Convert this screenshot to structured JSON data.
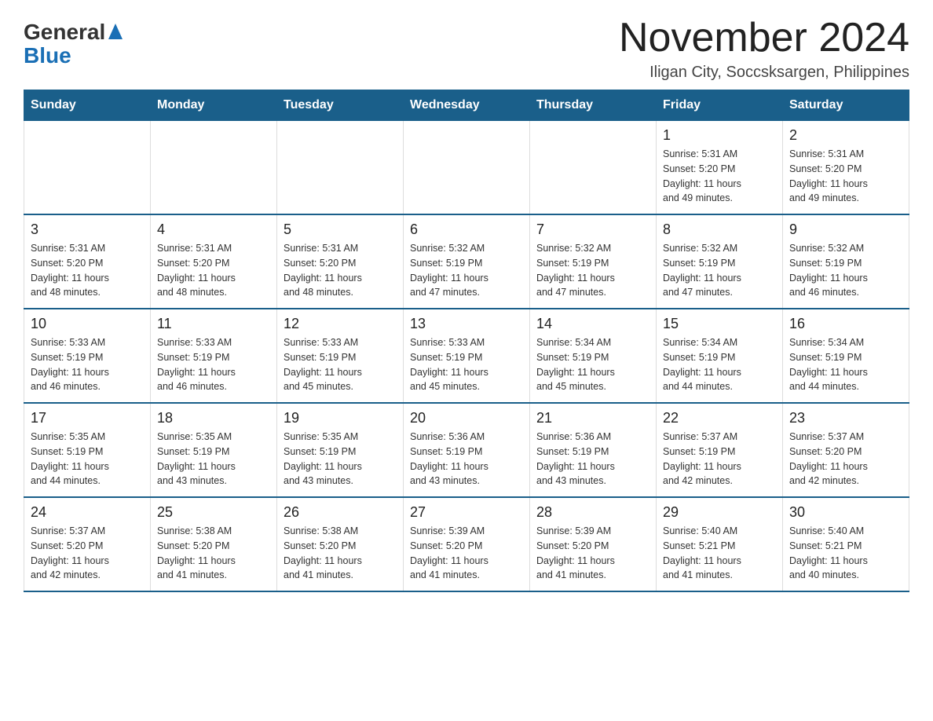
{
  "header": {
    "title": "November 2024",
    "location": "Iligan City, Soccsksargen, Philippines"
  },
  "logo": {
    "general": "General",
    "blue": "Blue"
  },
  "days_of_week": [
    "Sunday",
    "Monday",
    "Tuesday",
    "Wednesday",
    "Thursday",
    "Friday",
    "Saturday"
  ],
  "weeks": [
    [
      {
        "day": "",
        "info": ""
      },
      {
        "day": "",
        "info": ""
      },
      {
        "day": "",
        "info": ""
      },
      {
        "day": "",
        "info": ""
      },
      {
        "day": "",
        "info": ""
      },
      {
        "day": "1",
        "info": "Sunrise: 5:31 AM\nSunset: 5:20 PM\nDaylight: 11 hours\nand 49 minutes."
      },
      {
        "day": "2",
        "info": "Sunrise: 5:31 AM\nSunset: 5:20 PM\nDaylight: 11 hours\nand 49 minutes."
      }
    ],
    [
      {
        "day": "3",
        "info": "Sunrise: 5:31 AM\nSunset: 5:20 PM\nDaylight: 11 hours\nand 48 minutes."
      },
      {
        "day": "4",
        "info": "Sunrise: 5:31 AM\nSunset: 5:20 PM\nDaylight: 11 hours\nand 48 minutes."
      },
      {
        "day": "5",
        "info": "Sunrise: 5:31 AM\nSunset: 5:20 PM\nDaylight: 11 hours\nand 48 minutes."
      },
      {
        "day": "6",
        "info": "Sunrise: 5:32 AM\nSunset: 5:19 PM\nDaylight: 11 hours\nand 47 minutes."
      },
      {
        "day": "7",
        "info": "Sunrise: 5:32 AM\nSunset: 5:19 PM\nDaylight: 11 hours\nand 47 minutes."
      },
      {
        "day": "8",
        "info": "Sunrise: 5:32 AM\nSunset: 5:19 PM\nDaylight: 11 hours\nand 47 minutes."
      },
      {
        "day": "9",
        "info": "Sunrise: 5:32 AM\nSunset: 5:19 PM\nDaylight: 11 hours\nand 46 minutes."
      }
    ],
    [
      {
        "day": "10",
        "info": "Sunrise: 5:33 AM\nSunset: 5:19 PM\nDaylight: 11 hours\nand 46 minutes."
      },
      {
        "day": "11",
        "info": "Sunrise: 5:33 AM\nSunset: 5:19 PM\nDaylight: 11 hours\nand 46 minutes."
      },
      {
        "day": "12",
        "info": "Sunrise: 5:33 AM\nSunset: 5:19 PM\nDaylight: 11 hours\nand 45 minutes."
      },
      {
        "day": "13",
        "info": "Sunrise: 5:33 AM\nSunset: 5:19 PM\nDaylight: 11 hours\nand 45 minutes."
      },
      {
        "day": "14",
        "info": "Sunrise: 5:34 AM\nSunset: 5:19 PM\nDaylight: 11 hours\nand 45 minutes."
      },
      {
        "day": "15",
        "info": "Sunrise: 5:34 AM\nSunset: 5:19 PM\nDaylight: 11 hours\nand 44 minutes."
      },
      {
        "day": "16",
        "info": "Sunrise: 5:34 AM\nSunset: 5:19 PM\nDaylight: 11 hours\nand 44 minutes."
      }
    ],
    [
      {
        "day": "17",
        "info": "Sunrise: 5:35 AM\nSunset: 5:19 PM\nDaylight: 11 hours\nand 44 minutes."
      },
      {
        "day": "18",
        "info": "Sunrise: 5:35 AM\nSunset: 5:19 PM\nDaylight: 11 hours\nand 43 minutes."
      },
      {
        "day": "19",
        "info": "Sunrise: 5:35 AM\nSunset: 5:19 PM\nDaylight: 11 hours\nand 43 minutes."
      },
      {
        "day": "20",
        "info": "Sunrise: 5:36 AM\nSunset: 5:19 PM\nDaylight: 11 hours\nand 43 minutes."
      },
      {
        "day": "21",
        "info": "Sunrise: 5:36 AM\nSunset: 5:19 PM\nDaylight: 11 hours\nand 43 minutes."
      },
      {
        "day": "22",
        "info": "Sunrise: 5:37 AM\nSunset: 5:19 PM\nDaylight: 11 hours\nand 42 minutes."
      },
      {
        "day": "23",
        "info": "Sunrise: 5:37 AM\nSunset: 5:20 PM\nDaylight: 11 hours\nand 42 minutes."
      }
    ],
    [
      {
        "day": "24",
        "info": "Sunrise: 5:37 AM\nSunset: 5:20 PM\nDaylight: 11 hours\nand 42 minutes."
      },
      {
        "day": "25",
        "info": "Sunrise: 5:38 AM\nSunset: 5:20 PM\nDaylight: 11 hours\nand 41 minutes."
      },
      {
        "day": "26",
        "info": "Sunrise: 5:38 AM\nSunset: 5:20 PM\nDaylight: 11 hours\nand 41 minutes."
      },
      {
        "day": "27",
        "info": "Sunrise: 5:39 AM\nSunset: 5:20 PM\nDaylight: 11 hours\nand 41 minutes."
      },
      {
        "day": "28",
        "info": "Sunrise: 5:39 AM\nSunset: 5:20 PM\nDaylight: 11 hours\nand 41 minutes."
      },
      {
        "day": "29",
        "info": "Sunrise: 5:40 AM\nSunset: 5:21 PM\nDaylight: 11 hours\nand 41 minutes."
      },
      {
        "day": "30",
        "info": "Sunrise: 5:40 AM\nSunset: 5:21 PM\nDaylight: 11 hours\nand 40 minutes."
      }
    ]
  ]
}
